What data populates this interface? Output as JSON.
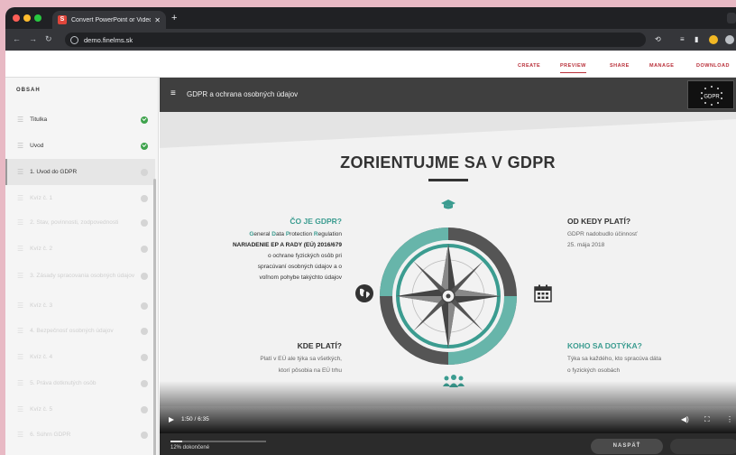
{
  "browser": {
    "tab_title": "Convert PowerPoint or Video",
    "tab_favicon_letter": "S",
    "url": "demo.finelms.sk"
  },
  "topnav": {
    "items": [
      {
        "label": "CREATE",
        "active": false
      },
      {
        "label": "PREVIEW",
        "active": true
      },
      {
        "label": "SHARE",
        "active": false
      },
      {
        "label": "MANAGE",
        "active": false
      },
      {
        "label": "DOWNLOAD",
        "active": false
      }
    ]
  },
  "sidebar": {
    "header": "OBSAH",
    "items": [
      {
        "label": "Titulka",
        "status": "done"
      },
      {
        "label": "Úvod",
        "status": "done"
      },
      {
        "label": "1. Úvod do GDPR",
        "status": "current"
      },
      {
        "label": "Kvíz č. 1",
        "status": "locked"
      },
      {
        "label": "2. Stav, povinnosti, zodpovednosti",
        "status": "locked"
      },
      {
        "label": "Kvíz č. 2",
        "status": "locked"
      },
      {
        "label": "3. Zásady spracovania osobných údajov",
        "status": "locked"
      },
      {
        "label": "Kvíz č. 3",
        "status": "locked"
      },
      {
        "label": "4. Bezpečnosť osobných údajov",
        "status": "locked"
      },
      {
        "label": "Kvíz č. 4",
        "status": "locked"
      },
      {
        "label": "5. Práva dotknutých osôb",
        "status": "locked"
      },
      {
        "label": "Kvíz č. 5",
        "status": "locked"
      },
      {
        "label": "6. Súhrn GDPR",
        "status": "locked"
      }
    ]
  },
  "content": {
    "header_title": "GDPR a ochrana osobných údajov",
    "logo_text": "GDPR"
  },
  "slide": {
    "title": "ZORIENTUJME SA V GDPR",
    "what": {
      "heading": "ČO JE GDPR?",
      "line1": "General Data Protection Regulation",
      "line2": "NARIADENIE EP A RADY (EÚ) 2016/679",
      "line3": "o ochrane fyzických osôb pri",
      "line4": "spracúvaní osobných údajov a o",
      "line5": "voľnom pohybe takýchto údajov"
    },
    "since": {
      "heading": "OD KEDY PLATÍ?",
      "line1": "GDPR nadobudlo účinnosť",
      "line2": "25. mája 2018"
    },
    "where": {
      "heading": "KDE PLATÍ?",
      "line1": "Platí v EÚ ale týka sa všetkých,",
      "line2": "ktorí pôsobia na EÚ trhu"
    },
    "who": {
      "heading": "KOHO SA DOTÝKA?",
      "line1": "Týka sa každého, kto spracúva dáta",
      "line2": "o fyzických osobách"
    }
  },
  "video": {
    "time": "1:50 / 6:35",
    "progress": 0.12
  },
  "footer": {
    "progress_label": "12% dokončené",
    "progress": 0.12,
    "back_label": "NASPÄŤ"
  },
  "colors": {
    "accent_red": "#b9303a",
    "teal": "#3b9c90",
    "done_green": "#3fa34d"
  }
}
